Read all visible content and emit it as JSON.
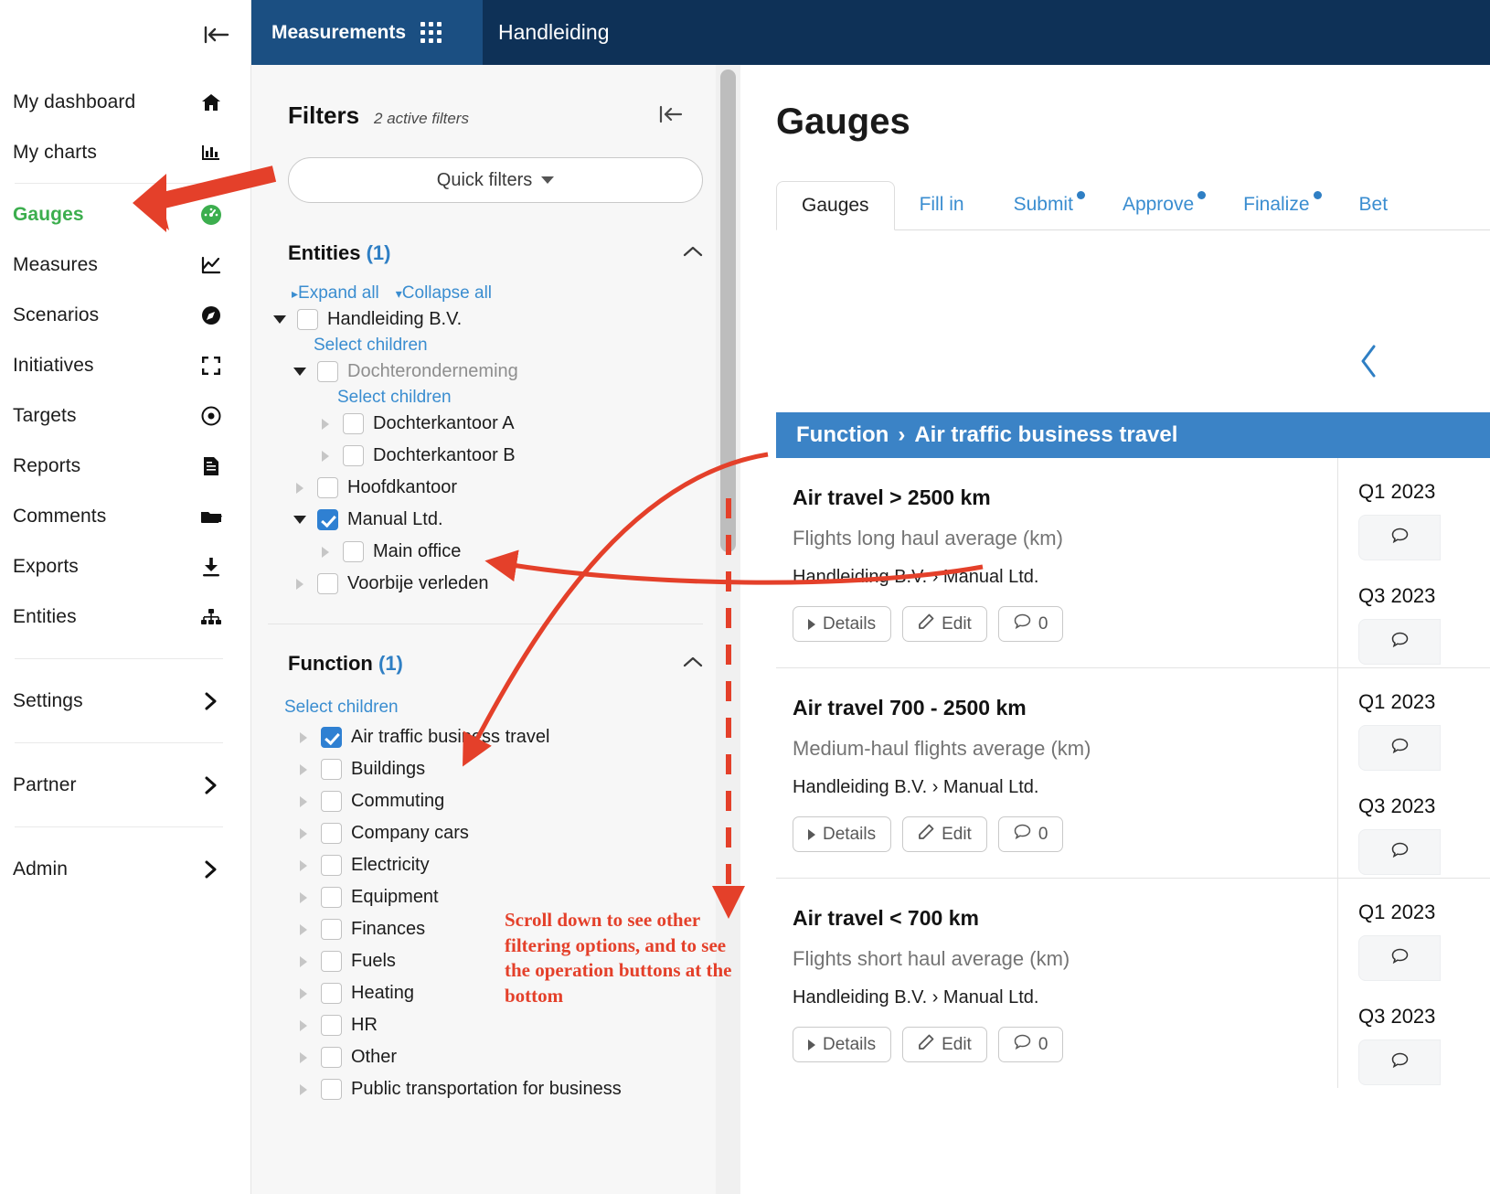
{
  "sidebar": {
    "collapse_icon": "collapse-left-icon",
    "items": [
      {
        "label": "My dashboard",
        "icon": "home-icon",
        "active": false
      },
      {
        "label": "My charts",
        "icon": "bar-chart-icon",
        "active": false
      },
      {
        "label": "Gauges",
        "icon": "gauge-icon",
        "active": true
      },
      {
        "label": "Measures",
        "icon": "line-chart-icon",
        "active": false
      },
      {
        "label": "Scenarios",
        "icon": "compass-icon",
        "active": false
      },
      {
        "label": "Initiatives",
        "icon": "expand-icon",
        "active": false
      },
      {
        "label": "Targets",
        "icon": "target-icon",
        "active": false
      },
      {
        "label": "Reports",
        "icon": "document-icon",
        "active": false
      },
      {
        "label": "Comments",
        "icon": "folder-icon",
        "active": false
      },
      {
        "label": "Exports",
        "icon": "download-icon",
        "active": false
      },
      {
        "label": "Entities",
        "icon": "sitemap-icon",
        "active": false
      }
    ],
    "groups": [
      {
        "label": "Settings",
        "icon": "chevron-right-icon"
      },
      {
        "label": "Partner",
        "icon": "chevron-right-icon"
      },
      {
        "label": "Admin",
        "icon": "chevron-right-icon"
      }
    ]
  },
  "topbar": {
    "app_name": "Measurements",
    "grid_icon": "app-grid-icon",
    "org_name": "Handleiding"
  },
  "filters": {
    "title": "Filters",
    "active_text": "2 active filters",
    "collapse_icon": "collapse-left-icon",
    "quick_filters_label": "Quick filters",
    "entities": {
      "title": "Entities",
      "count": "(1)",
      "expand_all": "Expand all",
      "collapse_all": "Collapse all",
      "select_children": "Select children",
      "nodes": [
        {
          "label": "Handleiding B.V.",
          "checked": false,
          "expanded": true,
          "muted": false,
          "indent": 0
        },
        {
          "label": "Dochteronderneming",
          "checked": false,
          "expanded": true,
          "muted": true,
          "indent": 1
        },
        {
          "label": "Dochterkantoor A",
          "checked": false,
          "expanded": false,
          "muted": false,
          "indent": 2
        },
        {
          "label": "Dochterkantoor B",
          "checked": false,
          "expanded": false,
          "muted": false,
          "indent": 2
        },
        {
          "label": "Hoofdkantoor",
          "checked": false,
          "expanded": false,
          "muted": false,
          "indent": 1
        },
        {
          "label": "Manual Ltd.",
          "checked": true,
          "expanded": true,
          "muted": false,
          "indent": 1
        },
        {
          "label": "Main office",
          "checked": false,
          "expanded": false,
          "muted": false,
          "indent": 2
        },
        {
          "label": "Voorbije verleden",
          "checked": false,
          "expanded": false,
          "muted": false,
          "indent": 1
        }
      ]
    },
    "function": {
      "title": "Function",
      "count": "(1)",
      "select_children": "Select children",
      "items": [
        {
          "label": "Air traffic business travel",
          "checked": true
        },
        {
          "label": "Buildings",
          "checked": false
        },
        {
          "label": "Commuting",
          "checked": false
        },
        {
          "label": "Company cars",
          "checked": false
        },
        {
          "label": "Electricity",
          "checked": false
        },
        {
          "label": "Equipment",
          "checked": false
        },
        {
          "label": "Finances",
          "checked": false
        },
        {
          "label": "Fuels",
          "checked": false
        },
        {
          "label": "Heating",
          "checked": false
        },
        {
          "label": "HR",
          "checked": false
        },
        {
          "label": "Other",
          "checked": false
        },
        {
          "label": "Public transportation for business",
          "checked": false
        }
      ]
    }
  },
  "annotation": {
    "text": "Scroll down to see other filtering options, and to see the operation buttons at the bottom",
    "color": "#e4402a"
  },
  "main": {
    "page_title": "Gauges",
    "prev_icon": "chevron-left-icon",
    "tabs": [
      {
        "label": "Gauges",
        "active": true,
        "dot": false
      },
      {
        "label": "Fill in",
        "active": false,
        "dot": false
      },
      {
        "label": "Submit",
        "active": false,
        "dot": true
      },
      {
        "label": "Approve",
        "active": false,
        "dot": true
      },
      {
        "label": "Finalize",
        "active": false,
        "dot": true
      },
      {
        "label": "Bet",
        "active": false,
        "dot": false
      }
    ],
    "function_banner": {
      "prefix": "Function",
      "separator": "›",
      "name": "Air traffic business travel"
    },
    "buttons": {
      "details": "Details",
      "edit": "Edit",
      "comments_count": "0"
    },
    "cards": [
      {
        "title": "Air travel > 2500 km",
        "subtitle": "Flights long haul average (km)",
        "path": "Handleiding B.V. › Manual Ltd.",
        "periods": [
          "Q1 2023",
          "Q3 2023"
        ]
      },
      {
        "title": "Air travel 700 - 2500 km",
        "subtitle": "Medium-haul flights average (km)",
        "path": "Handleiding B.V. › Manual Ltd.",
        "periods": [
          "Q1 2023",
          "Q3 2023"
        ]
      },
      {
        "title": "Air travel < 700 km",
        "subtitle": "Flights short haul average (km)",
        "path": "Handleiding B.V. › Manual Ltd.",
        "periods": [
          "Q1 2023",
          "Q3 2023"
        ]
      }
    ]
  },
  "colors": {
    "topbar_dark": "#0e3157",
    "topbar_app": "#1b4f82",
    "accent_blue": "#3b83c6",
    "link_blue": "#3a8dd0",
    "active_green": "#3cae4e",
    "annotation_red": "#e4402a"
  }
}
